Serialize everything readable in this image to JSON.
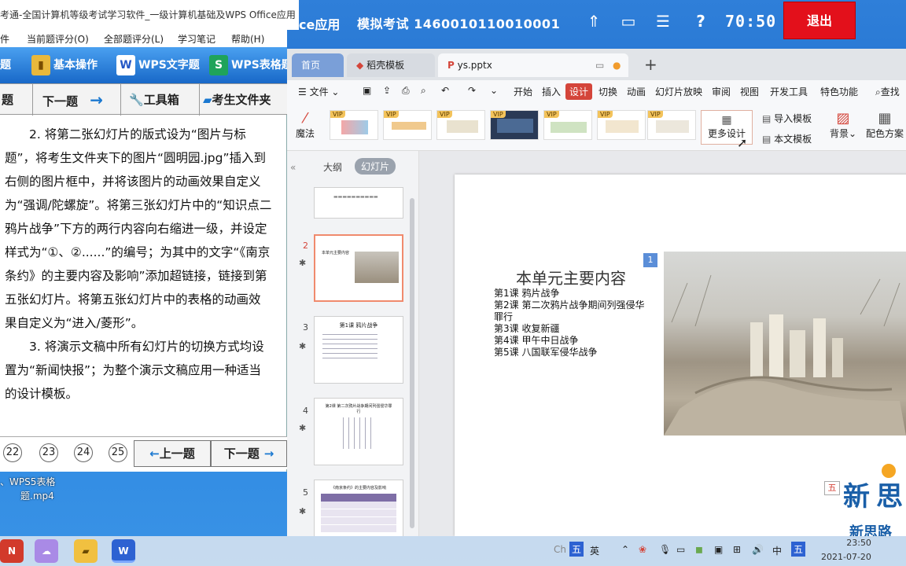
{
  "exam_bar": {
    "app_label": "ce应用",
    "title": "模拟考试 1460010110010001",
    "timer": "70:50",
    "exit_label": "退出"
  },
  "exam_window": {
    "title": "考通-全国计算机等级考试学习软件_一级计算机基础及WPS Office应用",
    "menu": [
      "件",
      "当前题评分(O)",
      "全部题评分(L)",
      "学习笔记",
      "帮助(H)"
    ],
    "toolbar": [
      "题",
      "基本操作",
      "WPS文字题",
      "WPS表格题"
    ],
    "nav": [
      "题",
      "下一题",
      "工具箱",
      "考生文件夹"
    ],
    "question_paragraphs": [
      "2. 将第二张幻灯片的版式设为“图片与标题”，将考生文件夹下的图片“圆明园.jpg”插入到右侧的图片框中，并将该图片的动画效果自定义为“强调/陀螺旋”。将第三张幻灯片中的“知识点二  鸦片战争”下方的两行内容向右缩进一级，并设定样式为“①、②......”的编号；为其中的文字“《南京条约》的主要内容及影响”添加超链接，链接到第五张幻灯片。将第五张幻灯片中的表格的动画效果自定义为“进入/菱形”。",
      "3. 将演示文稿中所有幻灯片的切换方式均设置为“新闻快报”；为整个演示文稿应用一种适当的设计模板。"
    ],
    "question_numbers": [
      "22",
      "23",
      "24",
      "25"
    ],
    "prev_label": "上一题",
    "next_label": "下一题"
  },
  "desktop_file": {
    "line1": "、WPS5表格",
    "line2": "题.mp4"
  },
  "wps": {
    "tabs": [
      "首页",
      "稻壳模板",
      "ys.pptx"
    ],
    "menu_file": "文件",
    "menu_items": [
      "开始",
      "插入",
      "设计",
      "切换",
      "动画",
      "幻灯片放映",
      "审阅",
      "视图",
      "开发工具",
      "特色功能"
    ],
    "search": "查找",
    "magic_label": "魔法",
    "more_design": "更多设计",
    "import_template": "导入模板",
    "this_template": "本文模板",
    "background": "背景",
    "color_scheme": "配色方案",
    "vip": "VIP",
    "pane_tabs": [
      "大纲",
      "幻灯片"
    ],
    "thumbs": [
      {
        "num": "2",
        "title": "本单元主要内容"
      },
      {
        "num": "3",
        "title": "第1课  鸦片战争"
      },
      {
        "num": "4",
        "title": "第2课  第二次鸦片战争期间列强侵华罪行"
      },
      {
        "num": "5",
        "title": "《南京条约》的主要内容及影响"
      }
    ],
    "slide": {
      "placeholder_num": "1",
      "title": "本单元主要内容",
      "lines": [
        "第1课  鸦片战争",
        "第2课  第二次鸦片战争期间列强侵华罪行",
        "第3课  收复新疆",
        "第4课  甲午中日战争",
        "第5课  八国联军侵华战争"
      ]
    }
  },
  "taskbar": {
    "ime": "五",
    "ime2": "英",
    "lang": "中",
    "time": "23:50",
    "date": "2021-07-20",
    "ch_label": "Ch"
  },
  "logo": {
    "text": "新思路"
  },
  "colors": {
    "exam_blue": "#1f6fcc",
    "exit_red": "#e3101b",
    "wps_accent": "#d4453a"
  }
}
